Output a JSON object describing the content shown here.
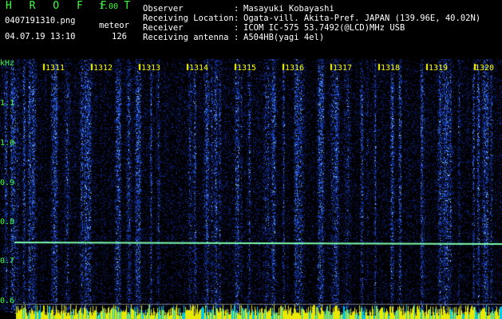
{
  "app": {
    "logo": "H R O F F T",
    "version": "1.00",
    "filename": "0407191310.png",
    "datetime": "04.07.19 13:10",
    "mode": "meteor",
    "count": "126"
  },
  "info": [
    {
      "label": "Observer",
      "value": "Masayuki Kobayashi"
    },
    {
      "label": "Receiving Location",
      "value": "Ogata-vill. Akita-Pref. JAPAN (139.96E, 40.02N)"
    },
    {
      "label": "Receiver",
      "value": "ICOM IC-575 53.7492(@LCD)MHz USB"
    },
    {
      "label": "Receiving antenna",
      "value": "A504HB(yagi 4el)"
    }
  ],
  "colors": {
    "label": "#3cff3c",
    "minute": "#ffff00",
    "signal": "#1a2fff",
    "carrier": "#80ffb0"
  },
  "spectrogram": {
    "y_unit": "kHz",
    "y_ticks": [
      "1.1",
      "1.0",
      "0.9",
      "0.8",
      "0.7",
      "0.6"
    ],
    "minute_labels": [
      "1311",
      "1312",
      "1313",
      "1314",
      "1315",
      "1316",
      "1317",
      "1318",
      "1319",
      "1320"
    ],
    "carrier_khz": 0.76,
    "freq_range_khz": [
      0.585,
      1.185
    ],
    "noise_floor_lines_khz": [
      0.62,
      0.6
    ]
  }
}
